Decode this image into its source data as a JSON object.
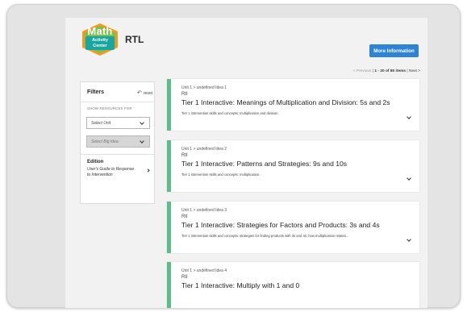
{
  "brand": {
    "logo_line1": "Math",
    "logo_line2": "Activity",
    "logo_line3": "Center",
    "title": "RTL"
  },
  "header": {
    "more_info_label": "More Information"
  },
  "pager": {
    "prev": "< Previous",
    "range": "1 - 20 of 80 items",
    "next": "Next >"
  },
  "filters": {
    "title": "Filters",
    "reset": "reset",
    "show_label": "SHOW RESOURCES FOR",
    "unit_select": "Select Unit",
    "bigidea_select": "Select Big Idea",
    "edition_title": "Edition",
    "edition_link": "User's Guide to Response to Intervention"
  },
  "cards": [
    {
      "breadcrumb": "Unit 1 > undefined Idea 1",
      "tag": "RtI",
      "title": "Tier 1 Interactive: Meanings of Multiplication and Division: 5s and 2s",
      "desc": "Tier 1 intervention skills and concepts: multiplication and division."
    },
    {
      "breadcrumb": "Unit 1 > undefined Idea 2",
      "tag": "RtI",
      "title": "Tier 1 Interactive: Patterns and Strategies: 9s and 10s",
      "desc": "Tier 1 intervention skills and concepts: multiplication."
    },
    {
      "breadcrumb": "Unit 1 > undefined Idea 3",
      "tag": "RtI",
      "title": "Tier 1 Interactive: Strategies for Factors and Products: 3s and 4s",
      "desc": "Tier 1 intervention skills and concepts: strategies for finding products with 3s and 4s; how multiplication relates..."
    },
    {
      "breadcrumb": "Unit 1 > undefined Idea 4",
      "tag": "RtI",
      "title": "Tier 1 Interactive: Multiply with 1 and 0",
      "desc": ""
    }
  ],
  "colors": {
    "accent": "#2f83d6",
    "card_stripe": "#5cbf8a",
    "logo_green": "#7cc04b",
    "logo_orange": "#f29a1f",
    "logo_teal": "#1aa6a0"
  }
}
